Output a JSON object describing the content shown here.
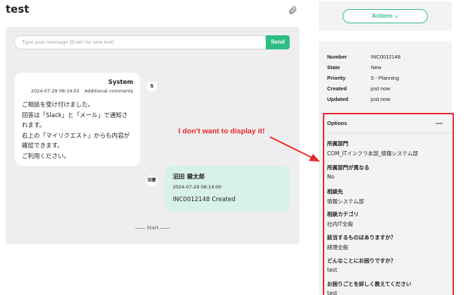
{
  "header": {
    "title": "test"
  },
  "composer": {
    "placeholder": "Type your message (Enter for new line)",
    "send_label": "Send"
  },
  "messages": [
    {
      "sender": "System",
      "avatar": "S",
      "timestamp": "2024-07-29 08:14:02",
      "type": "Additional comments",
      "body": "ご相談を受け付けました。\n回答は「Slack」と「メール」で通知されます。\n右上の「マイリクエスト」からも内容が確認できます。\nご利用ください。"
    },
    {
      "sender": "沼田 健太郎",
      "avatar": "沼健",
      "timestamp": "2024-07-29 08:14:00",
      "body": "INC0012148 Created"
    }
  ],
  "start_marker": "―― Start ――",
  "actions": {
    "label": "Actions ⌵"
  },
  "info": [
    {
      "key": "Number",
      "value": "INC0012148"
    },
    {
      "key": "State",
      "value": "New"
    },
    {
      "key": "Priority",
      "value": "5 - Planning"
    },
    {
      "key": "Created",
      "value": "just now"
    },
    {
      "key": "Updated",
      "value": "just now"
    }
  ],
  "options": {
    "title": "Options",
    "fields": [
      {
        "label": "所属部門",
        "value": "COM_ITインフラ本部_情報システム部"
      },
      {
        "label": "所属部門が異なる",
        "value": "No"
      },
      {
        "label": "相談先",
        "value": "情報システム部"
      },
      {
        "label": "相談カテゴリ",
        "value": "社内IT全般"
      },
      {
        "label": "該当するものはありますか？",
        "value": "経理全般"
      },
      {
        "label": "どんなことにお困りですか？",
        "value": "test"
      },
      {
        "label": "お困りごとを詳しく教えてください",
        "value": "test"
      }
    ]
  },
  "annotation": {
    "text": "I don't want to display it!",
    "color": "#e8272b"
  },
  "colors": {
    "accent": "#2ebd84",
    "user_bubble": "#d7f2e6",
    "panel": "#eeeeee"
  },
  "icons": {
    "attach": "paperclip-icon",
    "collapse": "minus-icon"
  }
}
